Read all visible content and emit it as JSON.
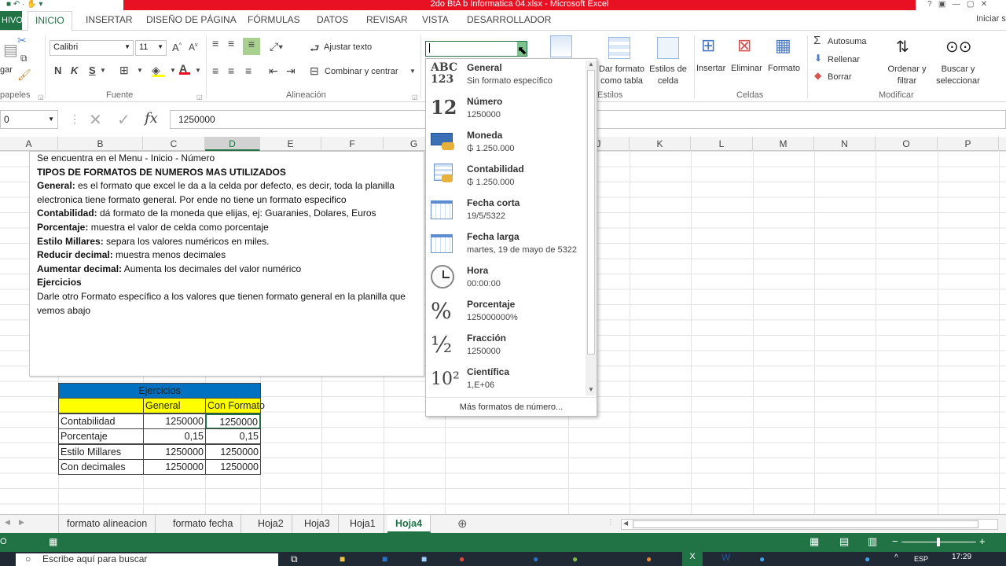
{
  "window": {
    "title": "2do BtA b Informatica 04.xlsx - Microsoft Excel",
    "sign_in": "Iniciar s"
  },
  "tabs": [
    "HIVO",
    "INICIO",
    "INSERTAR",
    "DISEÑO DE PÁGINA",
    "FÓRMULAS",
    "DATOS",
    "REVISAR",
    "VISTA",
    "DESARROLLADOR"
  ],
  "ribbon": {
    "clipboard_label": "papeles",
    "clipboard_paste": "gar",
    "font_name": "Calibri",
    "font_size": "11",
    "font_label": "Fuente",
    "bold": "N",
    "italic": "K",
    "underline": "S",
    "wrap_text": "Ajustar texto",
    "merge_center": "Combinar y centrar",
    "alignment_label": "Alineación",
    "number_format_value": "",
    "format_table": "Dar formato\ncomo tabla",
    "cell_styles": "Estilos de\ncelda",
    "styles_label": "Estilos",
    "insert": "Insertar",
    "delete": "Eliminar",
    "format": "Formato",
    "cells_label": "Celdas",
    "autosum": "Autosuma",
    "fill": "Rellenar",
    "clear": "Borrar",
    "sort_filter": "Ordenar y\nfiltrar",
    "find_select": "Buscar y\nseleccionar",
    "modify_label": "Modificar"
  },
  "formula_bar": {
    "name_box": "0",
    "value": "1250000",
    "fx": "fx"
  },
  "columns": [
    "A",
    "B",
    "C",
    "D",
    "E",
    "F",
    "G",
    "",
    "J",
    "K",
    "L",
    "M",
    "N",
    "O",
    "P"
  ],
  "textbox": {
    "line1": "Se encuentra en el Menu -  Inicio - Número",
    "heading": "TIPOS DE FORMATOS DE NUMEROS MAS UTILIZADOS",
    "general_b": "General:",
    "general_t": "  es el formato que excel le da a la celda por defecto, es decir,  toda la planilla electronica tiene formato general. Por ende no tiene un formato especifico",
    "cont_b": "Contabilidad:",
    "cont_t": "  dá formato de la moneda que elijas, ej: Guaranies, Dolares, Euros",
    "pct_b": "Porcentaje:",
    "pct_t": " muestra el valor de celda como porcentaje",
    "mill_b": "Estilo Millares:",
    "mill_t": " separa los valores numéricos en miles.",
    "red_b": "Reducir decimal:",
    "red_t": " muestra menos decimales",
    "aum_b": "Aumentar decimal:",
    "aum_t": " Aumenta  los decimales  del valor numérico",
    "ej_b": "Ejercicios",
    "ej_t": "Darle otro  Formato específico  a los valores que tienen  formato general en la planilla que vemos abajo"
  },
  "table": {
    "title": "Ejercicios",
    "col_general": "General",
    "col_format": "Con Formato",
    "rows": [
      {
        "label": "Contabilidad",
        "general": "1250000",
        "format": "1250000"
      },
      {
        "label": "Porcentaje",
        "general": "0,15",
        "format": "0,15"
      },
      {
        "label": "Estilo Millares",
        "general": "1250000",
        "format": "1250000"
      },
      {
        "label": "Con decimales",
        "general": "1250000",
        "format": "1250000"
      }
    ]
  },
  "dropdown": {
    "items": [
      {
        "name": "General",
        "value": "Sin formato específico",
        "glyph": "ABC\n123"
      },
      {
        "name": "Número",
        "value": "1250000",
        "glyph": "12"
      },
      {
        "name": "Moneda",
        "value": "₲ 1.250.000",
        "glyph": ""
      },
      {
        "name": "Contabilidad",
        "value": " ₲ 1.250.000",
        "glyph": ""
      },
      {
        "name": "Fecha corta",
        "value": "19/5/5322",
        "glyph": ""
      },
      {
        "name": "Fecha larga",
        "value": "martes, 19 de mayo de 5322",
        "glyph": ""
      },
      {
        "name": "Hora",
        "value": "00:00:00",
        "glyph": ""
      },
      {
        "name": "Porcentaje",
        "value": "125000000%",
        "glyph": "%"
      },
      {
        "name": "Fracción",
        "value": "1250000",
        "glyph": "½"
      },
      {
        "name": "Científica",
        "value": "1,E+06",
        "glyph": "10²"
      }
    ],
    "more": "Más formatos de número..."
  },
  "sheets": [
    "formato alineacion",
    "formato fecha",
    "Hoja2",
    "Hoja3",
    "Hoja1",
    "Hoja4"
  ],
  "active_sheet": "Hoja4",
  "taskbar": {
    "search": "Escribe aquí para buscar",
    "lang": "ESP",
    "time": "17:29"
  },
  "colors": {
    "excel_green": "#217346",
    "title_red": "#e81123",
    "table_title_bg": "#0070c0",
    "table_header_bg": "#ffff00"
  }
}
